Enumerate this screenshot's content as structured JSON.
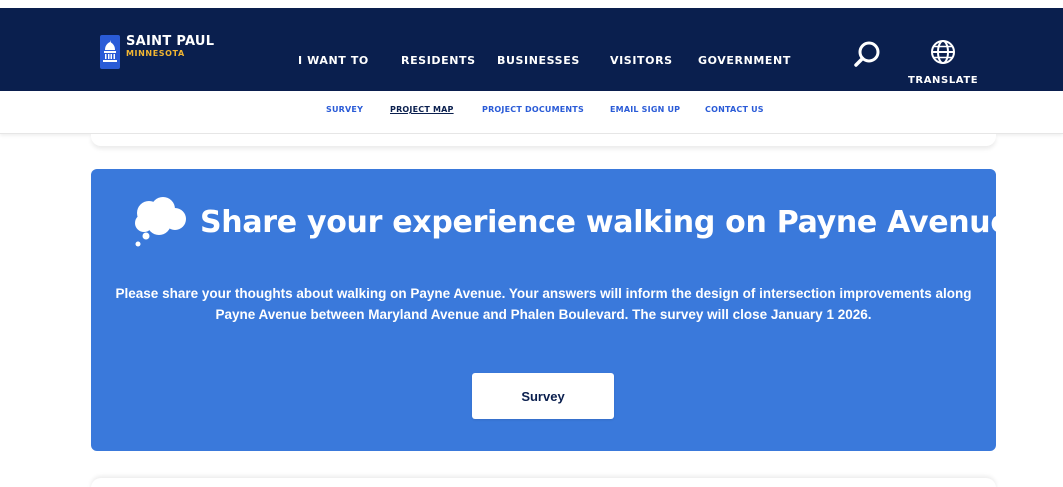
{
  "header": {
    "logo": {
      "city": "SAINT PAUL",
      "state": "MINNESOTA"
    },
    "nav": [
      "I WANT TO",
      "RESIDENTS",
      "BUSINESSES",
      "VISITORS",
      "GOVERNMENT"
    ],
    "search_icon": "search-icon",
    "translate_label": "TRANSLATE",
    "translate_icon": "globe-icon",
    "background_color": "#0a1f4e"
  },
  "subnav": {
    "items": [
      "SURVEY",
      "PROJECT MAP",
      "PROJECT DOCUMENTS",
      "EMAIL SIGN UP",
      "CONTACT US"
    ],
    "active": "PROJECT MAP",
    "link_color": "#2a5bd7"
  },
  "banner": {
    "icon": "thought-cloud-icon",
    "title": "Share your experience walking on Payne Avenue",
    "body": "Please share your thoughts about walking on Payne Avenue. Your answers will inform the design of intersection improvements along Payne Avenue between Maryland Avenue and Phalen Boulevard. The survey will close January 1 2026.",
    "button_label": "Survey",
    "background_color": "#3a79db"
  }
}
